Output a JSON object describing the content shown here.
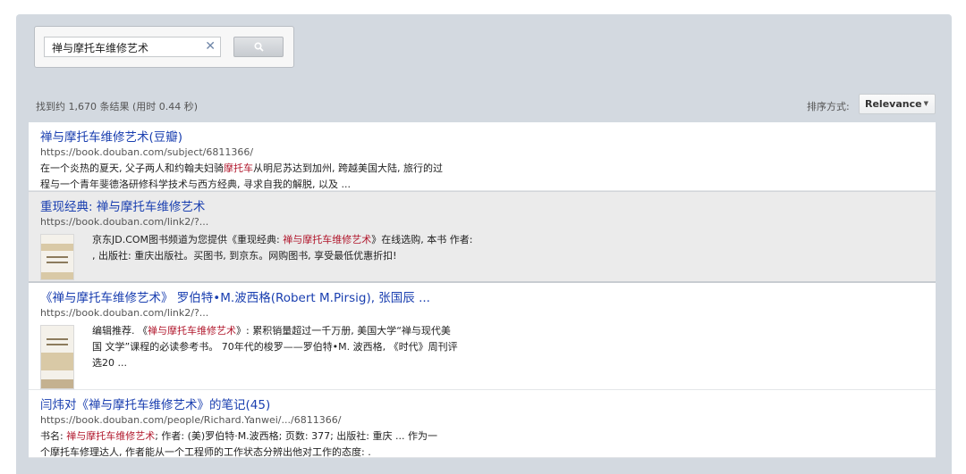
{
  "search": {
    "query": "禅与摩托车维修艺术",
    "clear_icon": "close-icon",
    "button_icon": "search-icon"
  },
  "summary": {
    "count_text": "找到约 1,670 条结果 (用时 0.44 秒)",
    "sort_label": "排序方式:",
    "sort_value": "Relevance"
  },
  "results": [
    {
      "title": "禅与摩托车维修艺术(豆瓣)",
      "url": "https://book.douban.com/subject/6811366/",
      "snippet": [
        {
          "t": "在一个炎热的夏天, 父子两人和约翰夫妇骑"
        },
        {
          "t": "摩托车",
          "hl": true
        },
        {
          "t": "从明尼苏达到加州, 跨越美国大陆, 旅行的过程与一个青年斐德洛研修科学技术与西方经典, 寻求自我的解脱, 以及 ..."
        }
      ]
    },
    {
      "title": "重现经典: 禅与摩托车维修艺术",
      "url": "https://book.douban.com/link2/?...",
      "thumbnail": "book-cover-thumbnail",
      "snippet": [
        {
          "t": "京东JD.COM图书频道为您提供《重现经典: "
        },
        {
          "t": "禅与摩托车维修艺术",
          "hl": true
        },
        {
          "t": "》在线选购, 本书 作者: , 出版社: 重庆出版社。买图书, 到京东。网购图书, 享受最低优惠折扣!"
        }
      ]
    },
    {
      "title": "《禅与摩托车维修艺术》 罗伯特•M.波西格(Robert M.Pirsig), 张国辰 ...",
      "url": "https://book.douban.com/link2/?...",
      "thumbnail": "book-cover-thumbnail",
      "snippet": [
        {
          "t": "编辑推荐. 《"
        },
        {
          "t": "禅与摩托车维修艺术",
          "hl": true
        },
        {
          "t": "》: 累积销量超过一千万册, 美国大学“禅与现代美国 文学”课程的必读参考书。 70年代的梭罗——罗伯特•M. 波西格, 《时代》周刊评选20 ..."
        }
      ]
    },
    {
      "title": "闫炜对《禅与摩托车维修艺术》的笔记(45)",
      "url": "https://book.douban.com/people/Richard.Yanwei/.../6811366/",
      "snippet": [
        {
          "t": "书名: "
        },
        {
          "t": "禅与摩托车维修艺术",
          "hl": true
        },
        {
          "t": "; 作者: (美)罗伯特·M.波西格; 页数: 377; 出版社: 重庆 ... 作为一个摩托车修理达人, 作者能从一个工程师的工作状态分辨出他对工作的态度: ."
        }
      ]
    }
  ]
}
